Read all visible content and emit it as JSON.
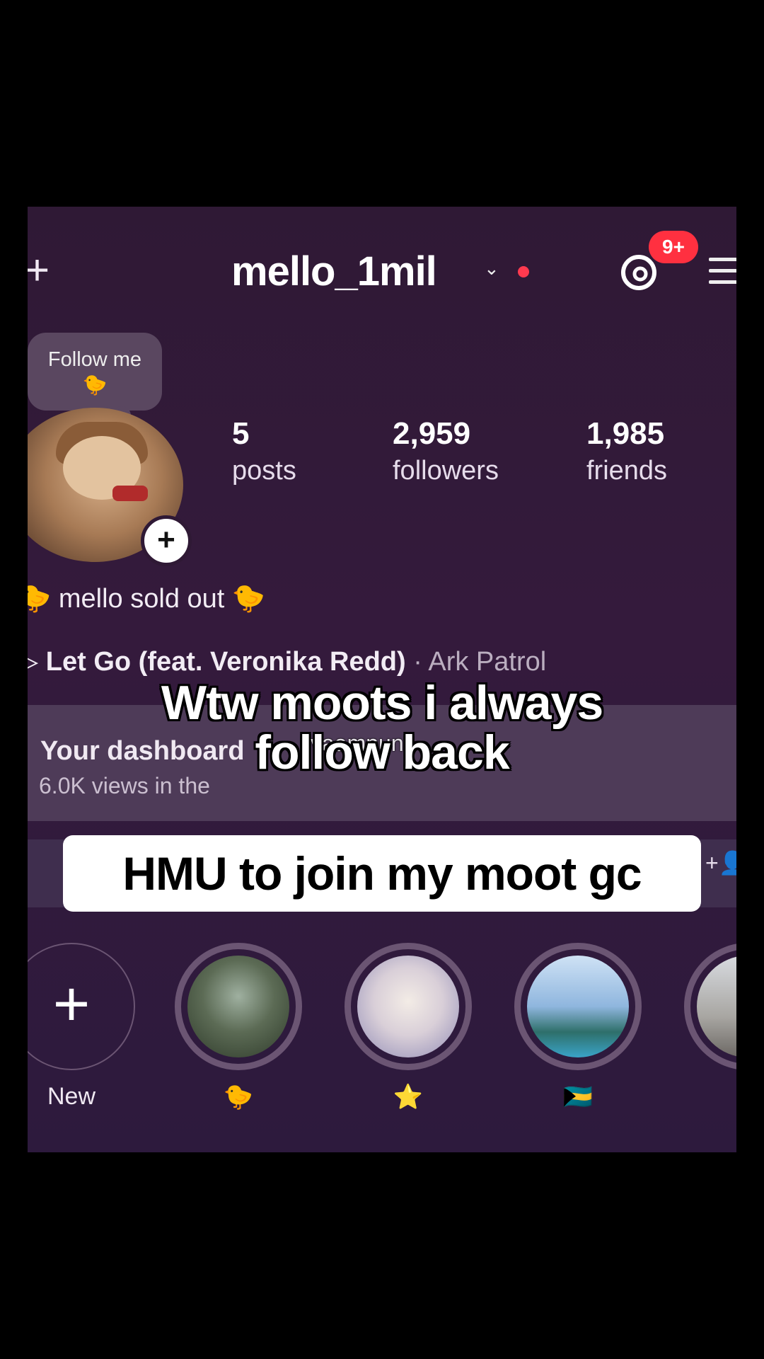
{
  "header": {
    "username": "mello_1mil",
    "notification_badge": "9+"
  },
  "note": {
    "text": "Follow me",
    "emoji": "🐤"
  },
  "stats": [
    {
      "value": "5",
      "label": "posts"
    },
    {
      "value": "2,959",
      "label": "followers"
    },
    {
      "value": "1,985",
      "label": "friends"
    }
  ],
  "bio": "🐤 mello sold out 🐤",
  "music": {
    "track": "Let Go (feat. Veronika Redd)",
    "artist": "· Ark Patrol"
  },
  "dashboard": {
    "title": "Your dashboard",
    "subtitle": "6.0K views in the",
    "overlay_fragment": "vaampun"
  },
  "highlights": [
    {
      "label": "New"
    },
    {
      "label": "🐤"
    },
    {
      "label": "⭐"
    },
    {
      "label": "🇧🇸"
    }
  ],
  "captions": {
    "line1": "Wtw moots i always",
    "line2": "follow back",
    "box": "HMU to join my moot gc"
  },
  "colors": {
    "background": "#2f1935",
    "badge": "#ff3040",
    "dashboard": "#4e3b58"
  }
}
